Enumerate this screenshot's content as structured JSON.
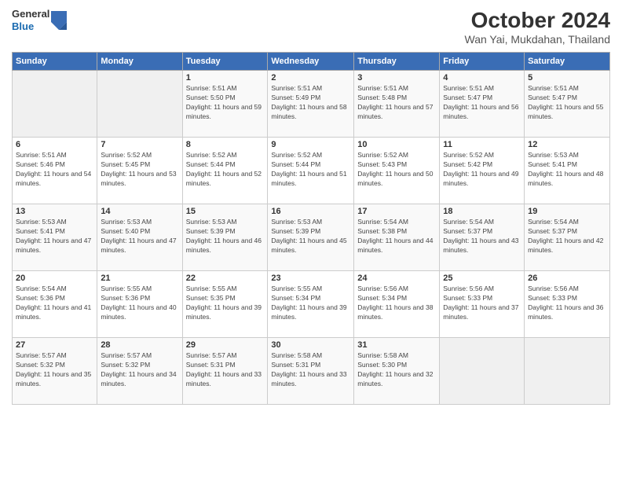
{
  "header": {
    "logo": {
      "general": "General",
      "blue": "Blue"
    },
    "title": "October 2024",
    "subtitle": "Wan Yai, Mukdahan, Thailand"
  },
  "calendar": {
    "weekdays": [
      "Sunday",
      "Monday",
      "Tuesday",
      "Wednesday",
      "Thursday",
      "Friday",
      "Saturday"
    ],
    "weeks": [
      [
        {
          "day": "",
          "info": ""
        },
        {
          "day": "",
          "info": ""
        },
        {
          "day": "1",
          "info": "Sunrise: 5:51 AM\nSunset: 5:50 PM\nDaylight: 11 hours and 59 minutes."
        },
        {
          "day": "2",
          "info": "Sunrise: 5:51 AM\nSunset: 5:49 PM\nDaylight: 11 hours and 58 minutes."
        },
        {
          "day": "3",
          "info": "Sunrise: 5:51 AM\nSunset: 5:48 PM\nDaylight: 11 hours and 57 minutes."
        },
        {
          "day": "4",
          "info": "Sunrise: 5:51 AM\nSunset: 5:47 PM\nDaylight: 11 hours and 56 minutes."
        },
        {
          "day": "5",
          "info": "Sunrise: 5:51 AM\nSunset: 5:47 PM\nDaylight: 11 hours and 55 minutes."
        }
      ],
      [
        {
          "day": "6",
          "info": "Sunrise: 5:51 AM\nSunset: 5:46 PM\nDaylight: 11 hours and 54 minutes."
        },
        {
          "day": "7",
          "info": "Sunrise: 5:52 AM\nSunset: 5:45 PM\nDaylight: 11 hours and 53 minutes."
        },
        {
          "day": "8",
          "info": "Sunrise: 5:52 AM\nSunset: 5:44 PM\nDaylight: 11 hours and 52 minutes."
        },
        {
          "day": "9",
          "info": "Sunrise: 5:52 AM\nSunset: 5:44 PM\nDaylight: 11 hours and 51 minutes."
        },
        {
          "day": "10",
          "info": "Sunrise: 5:52 AM\nSunset: 5:43 PM\nDaylight: 11 hours and 50 minutes."
        },
        {
          "day": "11",
          "info": "Sunrise: 5:52 AM\nSunset: 5:42 PM\nDaylight: 11 hours and 49 minutes."
        },
        {
          "day": "12",
          "info": "Sunrise: 5:53 AM\nSunset: 5:41 PM\nDaylight: 11 hours and 48 minutes."
        }
      ],
      [
        {
          "day": "13",
          "info": "Sunrise: 5:53 AM\nSunset: 5:41 PM\nDaylight: 11 hours and 47 minutes."
        },
        {
          "day": "14",
          "info": "Sunrise: 5:53 AM\nSunset: 5:40 PM\nDaylight: 11 hours and 47 minutes."
        },
        {
          "day": "15",
          "info": "Sunrise: 5:53 AM\nSunset: 5:39 PM\nDaylight: 11 hours and 46 minutes."
        },
        {
          "day": "16",
          "info": "Sunrise: 5:53 AM\nSunset: 5:39 PM\nDaylight: 11 hours and 45 minutes."
        },
        {
          "day": "17",
          "info": "Sunrise: 5:54 AM\nSunset: 5:38 PM\nDaylight: 11 hours and 44 minutes."
        },
        {
          "day": "18",
          "info": "Sunrise: 5:54 AM\nSunset: 5:37 PM\nDaylight: 11 hours and 43 minutes."
        },
        {
          "day": "19",
          "info": "Sunrise: 5:54 AM\nSunset: 5:37 PM\nDaylight: 11 hours and 42 minutes."
        }
      ],
      [
        {
          "day": "20",
          "info": "Sunrise: 5:54 AM\nSunset: 5:36 PM\nDaylight: 11 hours and 41 minutes."
        },
        {
          "day": "21",
          "info": "Sunrise: 5:55 AM\nSunset: 5:36 PM\nDaylight: 11 hours and 40 minutes."
        },
        {
          "day": "22",
          "info": "Sunrise: 5:55 AM\nSunset: 5:35 PM\nDaylight: 11 hours and 39 minutes."
        },
        {
          "day": "23",
          "info": "Sunrise: 5:55 AM\nSunset: 5:34 PM\nDaylight: 11 hours and 39 minutes."
        },
        {
          "day": "24",
          "info": "Sunrise: 5:56 AM\nSunset: 5:34 PM\nDaylight: 11 hours and 38 minutes."
        },
        {
          "day": "25",
          "info": "Sunrise: 5:56 AM\nSunset: 5:33 PM\nDaylight: 11 hours and 37 minutes."
        },
        {
          "day": "26",
          "info": "Sunrise: 5:56 AM\nSunset: 5:33 PM\nDaylight: 11 hours and 36 minutes."
        }
      ],
      [
        {
          "day": "27",
          "info": "Sunrise: 5:57 AM\nSunset: 5:32 PM\nDaylight: 11 hours and 35 minutes."
        },
        {
          "day": "28",
          "info": "Sunrise: 5:57 AM\nSunset: 5:32 PM\nDaylight: 11 hours and 34 minutes."
        },
        {
          "day": "29",
          "info": "Sunrise: 5:57 AM\nSunset: 5:31 PM\nDaylight: 11 hours and 33 minutes."
        },
        {
          "day": "30",
          "info": "Sunrise: 5:58 AM\nSunset: 5:31 PM\nDaylight: 11 hours and 33 minutes."
        },
        {
          "day": "31",
          "info": "Sunrise: 5:58 AM\nSunset: 5:30 PM\nDaylight: 11 hours and 32 minutes."
        },
        {
          "day": "",
          "info": ""
        },
        {
          "day": "",
          "info": ""
        }
      ]
    ]
  }
}
